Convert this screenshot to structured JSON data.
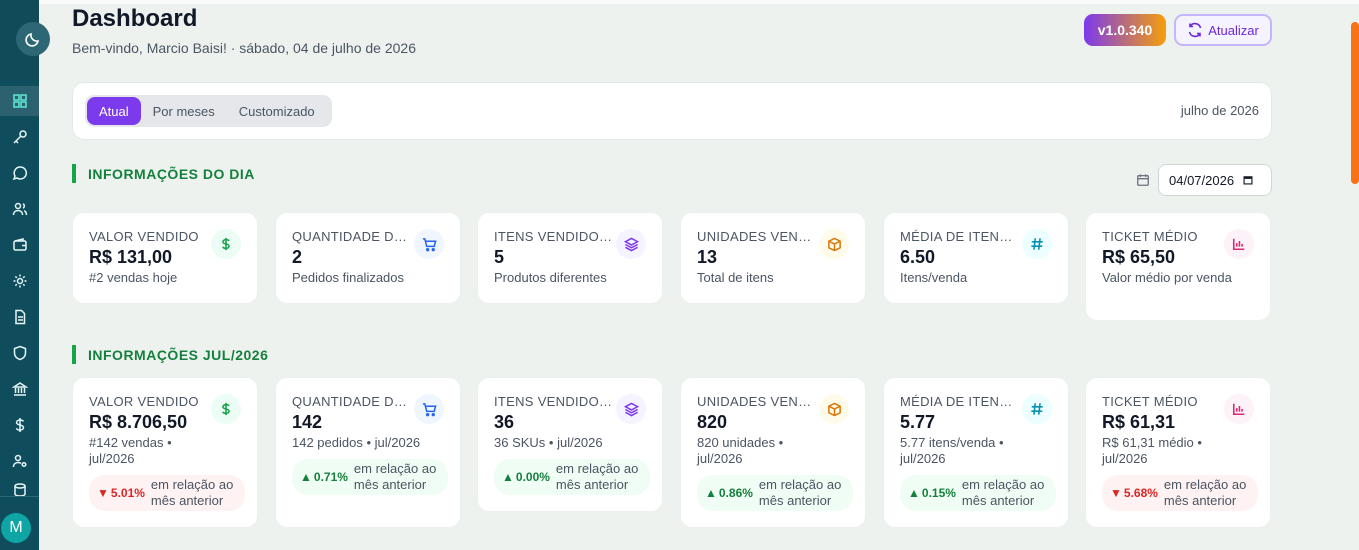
{
  "header": {
    "title": "Dashboard",
    "subtitle": "Bem-vindo, Marcio Baisi! · sábado, 04 de julho de 2026",
    "version": "v1.0.340",
    "refresh_label": "Atualizar"
  },
  "user": {
    "initial": "M"
  },
  "sidebar": {
    "icons": [
      "dashboard-icon",
      "key-icon",
      "chat-icon",
      "users-icon",
      "wallet-icon",
      "gear-icon",
      "document-icon",
      "shield-icon",
      "bank-icon",
      "dollar-icon",
      "user-key-icon",
      "database-icon"
    ]
  },
  "filter": {
    "tabs": [
      "Atual",
      "Por meses",
      "Customizado"
    ],
    "active_tab": "Atual",
    "period": "julho de 2026"
  },
  "day_section": {
    "title": "INFORMAÇÕES DO DIA",
    "date": "04/07/2026",
    "cards": [
      {
        "label": "VALOR VENDIDO",
        "value": "R$ 131,00",
        "sub": "#2 vendas hoje",
        "icon": "dollar-icon"
      },
      {
        "label": "QUANTIDADE DE V...",
        "value": "2",
        "sub": "Pedidos finalizados",
        "icon": "cart-icon"
      },
      {
        "label": "ITENS VENDIDOS (...",
        "value": "5",
        "sub": "Produtos diferentes",
        "icon": "layers-icon"
      },
      {
        "label": "UNIDADES VENDI...",
        "value": "13",
        "sub": "Total de itens",
        "icon": "box-icon"
      },
      {
        "label": "MÉDIA DE ITENS P...",
        "value": "6.50",
        "sub": "Itens/venda",
        "icon": "hash-icon"
      },
      {
        "label": "TICKET MÉDIO",
        "value": "R$ 65,50",
        "sub": "Valor médio por venda",
        "icon": "bar-chart-icon"
      }
    ]
  },
  "month_section": {
    "title": "INFORMAÇÕES JUL/2026",
    "cards": [
      {
        "label": "VALOR VENDIDO",
        "value": "R$ 8.706,50",
        "sub": "#142 vendas • jul/2026",
        "icon": "dollar-icon",
        "trend_dir": "down",
        "trend_arrow": "▼",
        "trend_pct": "5.01%",
        "trend_text": "em relação ao mês anterior"
      },
      {
        "label": "QUANTIDADE DE V...",
        "value": "142",
        "sub": "142 pedidos • jul/2026",
        "icon": "cart-icon",
        "trend_dir": "up",
        "trend_arrow": "▲",
        "trend_pct": "0.71%",
        "trend_text": "em relação ao mês anterior"
      },
      {
        "label": "ITENS VENDIDOS (...",
        "value": "36",
        "sub": "36 SKUs • jul/2026",
        "icon": "layers-icon",
        "trend_dir": "up",
        "trend_arrow": "▲",
        "trend_pct": "0.00%",
        "trend_text": "em relação ao mês anterior"
      },
      {
        "label": "UNIDADES VENDI...",
        "value": "820",
        "sub": "820 unidades • jul/2026",
        "icon": "box-icon",
        "trend_dir": "up",
        "trend_arrow": "▲",
        "trend_pct": "0.86%",
        "trend_text": "em relação ao mês anterior"
      },
      {
        "label": "MÉDIA DE ITENS P...",
        "value": "5.77",
        "sub": "5.77 itens/venda • jul/2026",
        "icon": "hash-icon",
        "trend_dir": "up",
        "trend_arrow": "▲",
        "trend_pct": "0.15%",
        "trend_text": "em relação ao mês anterior"
      },
      {
        "label": "TICKET MÉDIO",
        "value": "R$ 61,31",
        "sub": "R$ 61,31 médio • jul/2026",
        "icon": "bar-chart-icon",
        "trend_dir": "down",
        "trend_arrow": "▼",
        "trend_pct": "5.68%",
        "trend_text": "em relação ao mês anterior"
      }
    ]
  },
  "colors": {
    "accent": "#7c3aed",
    "sidebar": "#0f4c5c",
    "section_title": "#15803d",
    "trend_up": "#15803d",
    "trend_down": "#dc2626"
  }
}
